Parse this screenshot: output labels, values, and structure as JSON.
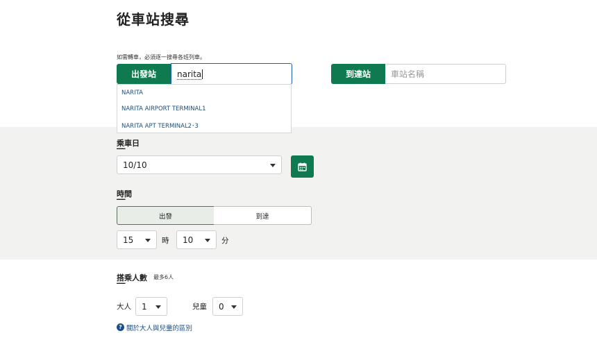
{
  "page": {
    "title": "從車站搜尋",
    "note": "如需轉車，必須逐一搜尋各班列車。"
  },
  "from": {
    "button_label": "出發站",
    "input_value": "narita",
    "suggestions": [
      "NARITA",
      "NARITA AIRPORT TERMINAL1",
      "NARITA APT TERMINAL2･3"
    ]
  },
  "to": {
    "button_label": "到達站",
    "input_placeholder": "車站名稱"
  },
  "date": {
    "label": "乘車日",
    "underline": "━━━",
    "value": "10/10",
    "calendar_icon": "calendar-icon"
  },
  "time": {
    "label": "時間",
    "underline": "━━━",
    "mode_options": [
      "出發",
      "到達"
    ],
    "selected_mode": "出發",
    "hour": "15",
    "hour_unit": "時",
    "minute": "10",
    "minute_unit": "分"
  },
  "passengers": {
    "label": "搭乘人數",
    "underline": "━━━",
    "max_note": "最多6人",
    "adult_label": "大人",
    "adult_value": "1",
    "child_label": "兒童",
    "child_value": "0",
    "help_link": "關於大人與兒童的區別",
    "help_icon": "question-icon"
  },
  "colors": {
    "accent": "#0f7a4f",
    "link": "#1a4e8a",
    "focus": "#1f5fb3"
  }
}
